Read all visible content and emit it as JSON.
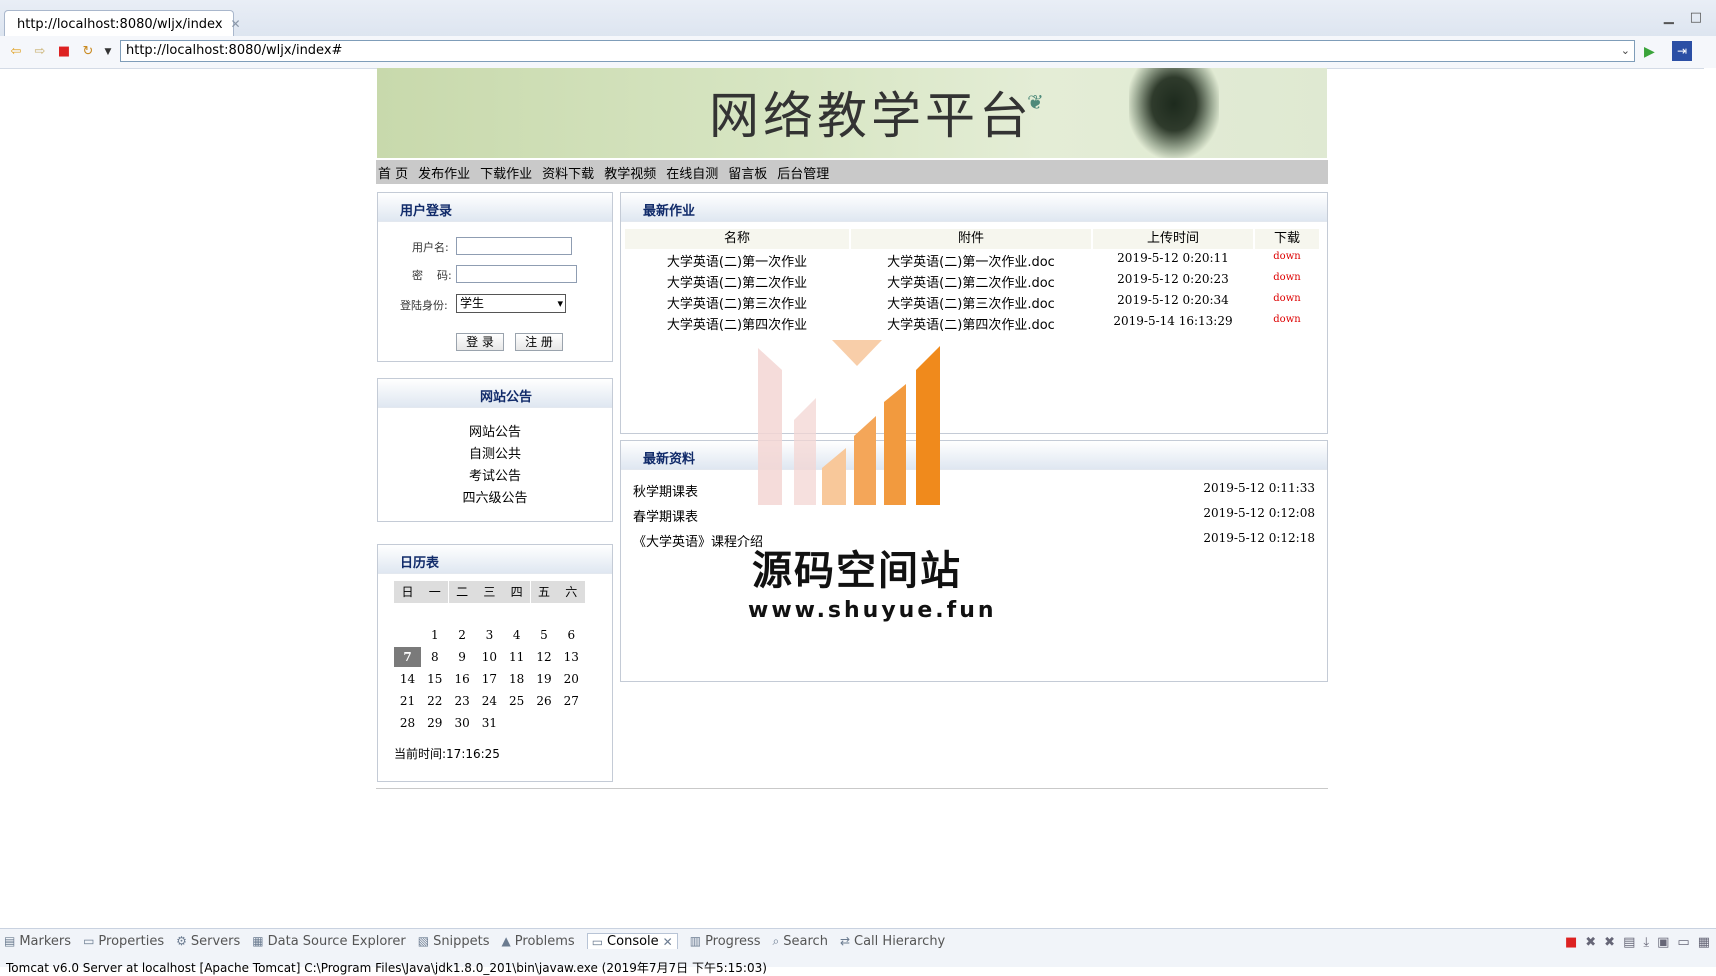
{
  "browser": {
    "tab_title": "http://localhost:8080/wljx/index",
    "url": "http://localhost:8080/wljx/index#"
  },
  "site": {
    "title": "网络教学平台",
    "nav": [
      "首 页",
      "发布作业",
      "下载作业",
      "资料下载",
      "教学视频",
      "在线自测",
      "留言板",
      "后台管理"
    ]
  },
  "login": {
    "header": "用户登录",
    "username_label": "用户名:",
    "password_label": "密    码:",
    "role_label": "登陆身份:",
    "role_value": "学生",
    "login_button": "登 录",
    "register_button": "注 册"
  },
  "notice": {
    "header": "网站公告",
    "items": [
      "网站公告",
      "自测公共",
      "考试公告",
      "四六级公告"
    ]
  },
  "calendar": {
    "header": "日历表",
    "weekdays": [
      "日",
      "一",
      "二",
      "三",
      "四",
      "五",
      "六"
    ],
    "weeks": [
      [
        "",
        "1",
        "2",
        "3",
        "4",
        "5",
        "6"
      ],
      [
        "7",
        "8",
        "9",
        "10",
        "11",
        "12",
        "13"
      ],
      [
        "14",
        "15",
        "16",
        "17",
        "18",
        "19",
        "20"
      ],
      [
        "21",
        "22",
        "23",
        "24",
        "25",
        "26",
        "27"
      ],
      [
        "28",
        "29",
        "30",
        "31",
        "",
        "",
        ""
      ]
    ],
    "today": "7",
    "current_time": "当前时间:17:16:25"
  },
  "homework": {
    "header": "最新作业",
    "columns": [
      "名称",
      "附件",
      "上传时间",
      "下载"
    ],
    "rows": [
      {
        "name": "大学英语(二)第一次作业",
        "file": "大学英语(二)第一次作业.doc",
        "time": "2019-5-12 0:20:11",
        "dl": "down"
      },
      {
        "name": "大学英语(二)第二次作业",
        "file": "大学英语(二)第二次作业.doc",
        "time": "2019-5-12 0:20:23",
        "dl": "down"
      },
      {
        "name": "大学英语(二)第三次作业",
        "file": "大学英语(二)第三次作业.doc",
        "time": "2019-5-12 0:20:34",
        "dl": "down"
      },
      {
        "name": "大学英语(二)第四次作业",
        "file": "大学英语(二)第四次作业.doc",
        "time": "2019-5-14 16:13:29",
        "dl": "down"
      }
    ]
  },
  "resources": {
    "header": "最新资料",
    "rows": [
      {
        "name": "秋学期课表",
        "time": "2019-5-12 0:11:33"
      },
      {
        "name": "春学期课表",
        "time": "2019-5-12 0:12:08"
      },
      {
        "name": "《大学英语》课程介绍",
        "time": "2019-5-12 0:12:18"
      }
    ]
  },
  "watermark": {
    "line1": "源码空间站",
    "line2": "www.shuyue.fun"
  },
  "bottom_panel": {
    "tabs": [
      "Markers",
      "Properties",
      "Servers",
      "Data Source Explorer",
      "Snippets",
      "Problems",
      "Console",
      "Progress",
      "Search",
      "Call Hierarchy"
    ],
    "active_tab": "Console",
    "status": "Tomcat v6.0 Server at localhost [Apache Tomcat] C:\\Program Files\\Java\\jdk1.8.0_201\\bin\\javaw.exe (2019年7月7日 下午5:15:03)"
  }
}
